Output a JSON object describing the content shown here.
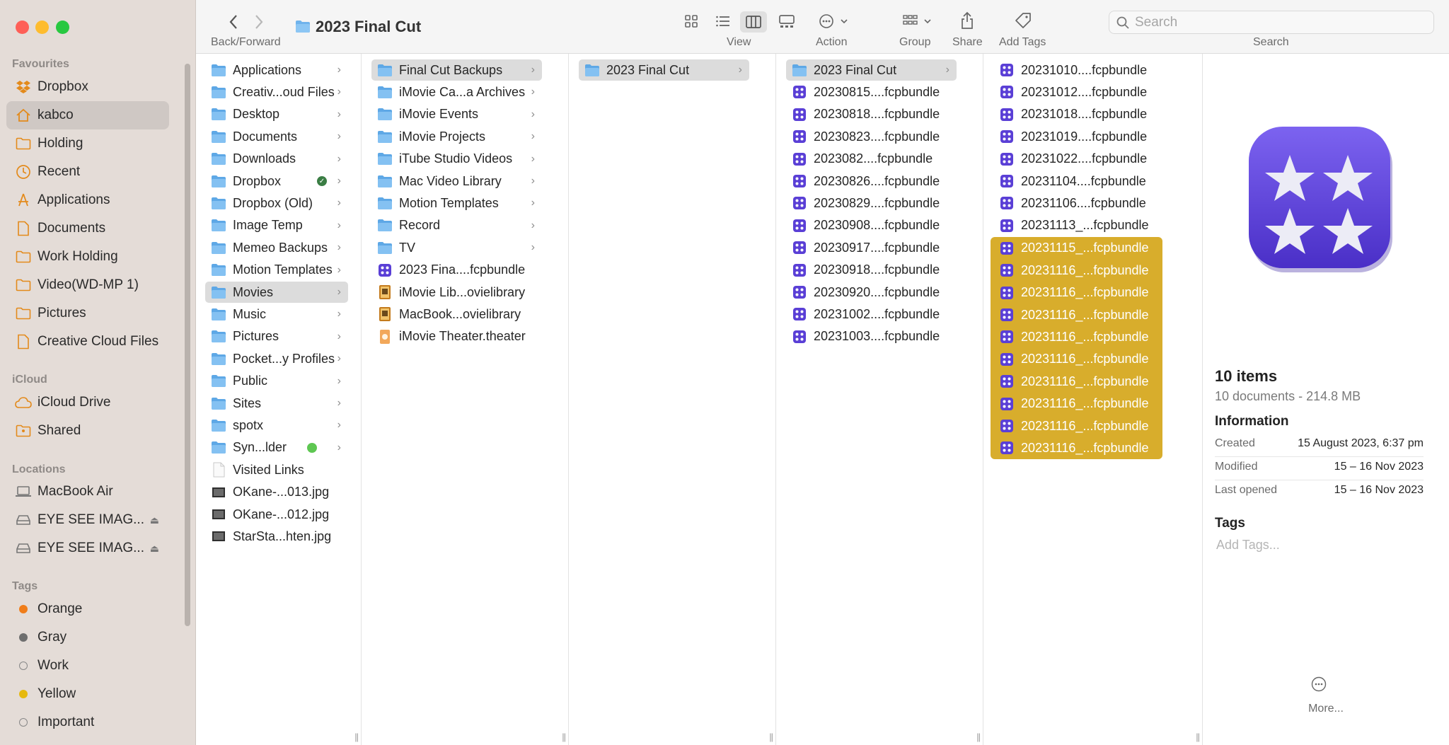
{
  "window": {
    "title": "2023 Final Cut"
  },
  "toolbar": {
    "nav_label": "Back/Forward",
    "view_label": "View",
    "action_label": "Action",
    "group_label": "Group",
    "share_label": "Share",
    "tags_label": "Add Tags",
    "search_label": "Search",
    "search_placeholder": "Search"
  },
  "sidebar": {
    "favourites_title": "Favourites",
    "favourites": [
      {
        "label": "Dropbox",
        "icon": "dropbox-icon"
      },
      {
        "label": "kabco",
        "icon": "home-icon",
        "selected": true
      },
      {
        "label": "Holding",
        "icon": "folder-icon"
      },
      {
        "label": "Recent",
        "icon": "clock-icon"
      },
      {
        "label": "Applications",
        "icon": "applications-icon"
      },
      {
        "label": "Documents",
        "icon": "document-icon"
      },
      {
        "label": "Work Holding",
        "icon": "folder-icon"
      },
      {
        "label": "Video(WD-MP 1)",
        "icon": "folder-icon"
      },
      {
        "label": "Pictures",
        "icon": "folder-icon"
      },
      {
        "label": "Creative Cloud Files",
        "icon": "document-icon"
      }
    ],
    "icloud_title": "iCloud",
    "icloud": [
      {
        "label": "iCloud Drive",
        "icon": "cloud-icon"
      },
      {
        "label": "Shared",
        "icon": "shared-folder-icon"
      }
    ],
    "locations_title": "Locations",
    "locations": [
      {
        "label": "MacBook Air",
        "icon": "laptop-icon"
      },
      {
        "label": "EYE SEE IMAG...",
        "icon": "drive-icon",
        "eject": true
      },
      {
        "label": "EYE SEE IMAG...",
        "icon": "drive-icon",
        "eject": true
      }
    ],
    "tags_title": "Tags",
    "tags": [
      {
        "label": "Orange",
        "color": "#f07d1a"
      },
      {
        "label": "Gray",
        "color": "#6e6e6e"
      },
      {
        "label": "Work",
        "color": ""
      },
      {
        "label": "Yellow",
        "color": "#e6b90e"
      },
      {
        "label": "Important",
        "color": ""
      }
    ]
  },
  "columns": [
    {
      "items": [
        {
          "label": "Applications",
          "kind": "folder",
          "chevron": true
        },
        {
          "label": "Creativ...oud Files",
          "kind": "folder",
          "chevron": true
        },
        {
          "label": "Desktop",
          "kind": "folder",
          "chevron": true
        },
        {
          "label": "Documents",
          "kind": "folder",
          "chevron": true
        },
        {
          "label": "Downloads",
          "kind": "folder",
          "chevron": true
        },
        {
          "label": "Dropbox",
          "kind": "folder",
          "chevron": true,
          "badge": "check"
        },
        {
          "label": "Dropbox (Old)",
          "kind": "folder",
          "chevron": true
        },
        {
          "label": "Image Temp",
          "kind": "folder",
          "chevron": true
        },
        {
          "label": "Memeo Backups",
          "kind": "folder",
          "chevron": true
        },
        {
          "label": "Motion Templates",
          "kind": "folder",
          "chevron": true
        },
        {
          "label": "Movies",
          "kind": "folder",
          "chevron": true,
          "selected": true
        },
        {
          "label": "Music",
          "kind": "folder",
          "chevron": true
        },
        {
          "label": "Pictures",
          "kind": "folder",
          "chevron": true
        },
        {
          "label": "Pocket...y Profiles",
          "kind": "folder",
          "chevron": true
        },
        {
          "label": "Public",
          "kind": "folder",
          "chevron": true
        },
        {
          "label": "Sites",
          "kind": "folder",
          "chevron": true
        },
        {
          "label": "spotx",
          "kind": "folder",
          "chevron": true
        },
        {
          "label": "Syn...lder",
          "kind": "folder",
          "chevron": true,
          "badge": "dot"
        },
        {
          "label": "Visited Links",
          "kind": "doc"
        },
        {
          "label": "OKane-...013.jpg",
          "kind": "image"
        },
        {
          "label": "OKane-...012.jpg",
          "kind": "image"
        },
        {
          "label": "StarSta...hten.jpg",
          "kind": "image"
        }
      ]
    },
    {
      "items": [
        {
          "label": "Final Cut Backups",
          "kind": "folder",
          "chevron": true,
          "selected": true
        },
        {
          "label": "iMovie Ca...a Archives",
          "kind": "folder",
          "chevron": true
        },
        {
          "label": "iMovie Events",
          "kind": "folder",
          "chevron": true
        },
        {
          "label": "iMovie Projects",
          "kind": "folder",
          "chevron": true
        },
        {
          "label": "iTube Studio Videos",
          "kind": "folder",
          "chevron": true
        },
        {
          "label": "Mac Video Library",
          "kind": "folder",
          "chevron": true
        },
        {
          "label": "Motion Templates",
          "kind": "folder",
          "chevron": true
        },
        {
          "label": "Record",
          "kind": "folder",
          "chevron": true
        },
        {
          "label": "TV",
          "kind": "folder",
          "chevron": true
        },
        {
          "label": "2023 Fina....fcpbundle",
          "kind": "fcp"
        },
        {
          "label": "iMovie Lib...ovielibrary",
          "kind": "imovie"
        },
        {
          "label": "MacBook...ovielibrary",
          "kind": "imovie"
        },
        {
          "label": "iMovie Theater.theater",
          "kind": "theater"
        }
      ]
    },
    {
      "items": [
        {
          "label": "2023 Final Cut",
          "kind": "folder",
          "chevron": true,
          "selected": true
        }
      ]
    },
    {
      "items": [
        {
          "label": "2023 Final Cut",
          "kind": "folder",
          "chevron": true,
          "selected": true
        },
        {
          "label": "20230815....fcpbundle",
          "kind": "fcp"
        },
        {
          "label": "20230818....fcpbundle",
          "kind": "fcp"
        },
        {
          "label": "20230823....fcpbundle",
          "kind": "fcp"
        },
        {
          "label": "2023082....fcpbundle",
          "kind": "fcp"
        },
        {
          "label": "20230826....fcpbundle",
          "kind": "fcp"
        },
        {
          "label": "20230829....fcpbundle",
          "kind": "fcp"
        },
        {
          "label": "20230908....fcpbundle",
          "kind": "fcp"
        },
        {
          "label": "20230917....fcpbundle",
          "kind": "fcp"
        },
        {
          "label": "20230918....fcpbundle",
          "kind": "fcp"
        },
        {
          "label": "20230920....fcpbundle",
          "kind": "fcp"
        },
        {
          "label": "20231002....fcpbundle",
          "kind": "fcp"
        },
        {
          "label": "20231003....fcpbundle",
          "kind": "fcp"
        }
      ]
    },
    {
      "items": [
        {
          "label": "20231010....fcpbundle",
          "kind": "fcp"
        },
        {
          "label": "20231012....fcpbundle",
          "kind": "fcp"
        },
        {
          "label": "20231018....fcpbundle",
          "kind": "fcp"
        },
        {
          "label": "20231019....fcpbundle",
          "kind": "fcp"
        },
        {
          "label": "20231022....fcpbundle",
          "kind": "fcp"
        },
        {
          "label": "20231104....fcpbundle",
          "kind": "fcp"
        },
        {
          "label": "20231106....fcpbundle",
          "kind": "fcp"
        },
        {
          "label": "20231113_...fcpbundle",
          "kind": "fcp"
        },
        {
          "label": "20231115_...fcpbundle",
          "kind": "fcp",
          "highlight": true
        },
        {
          "label": "20231116_...fcpbundle",
          "kind": "fcp",
          "highlight": true
        },
        {
          "label": "20231116_...fcpbundle",
          "kind": "fcp",
          "highlight": true
        },
        {
          "label": "20231116_...fcpbundle",
          "kind": "fcp",
          "highlight": true
        },
        {
          "label": "20231116_...fcpbundle",
          "kind": "fcp",
          "highlight": true
        },
        {
          "label": "20231116_...fcpbundle",
          "kind": "fcp",
          "highlight": true
        },
        {
          "label": "20231116_...fcpbundle",
          "kind": "fcp",
          "highlight": true
        },
        {
          "label": "20231116_...fcpbundle",
          "kind": "fcp",
          "highlight": true
        },
        {
          "label": "20231116_...fcpbundle",
          "kind": "fcp",
          "highlight": true
        },
        {
          "label": "20231116_...fcpbundle",
          "kind": "fcp",
          "highlight": true
        }
      ]
    }
  ],
  "preview": {
    "count": "10 items",
    "summary": "10 documents - 214.8 MB",
    "info_title": "Information",
    "created_label": "Created",
    "created_value": "15 August 2023, 6:37 pm",
    "modified_label": "Modified",
    "modified_value": "15 – 16 Nov 2023",
    "opened_label": "Last opened",
    "opened_value": "15 – 16 Nov 2023",
    "tags_title": "Tags",
    "tags_placeholder": "Add Tags...",
    "more_label": "More..."
  },
  "colors": {
    "selection_gold": "#d8ad2c",
    "fcp_purple": "#5a3fd6",
    "folder_blue": "#6fb3ec"
  }
}
